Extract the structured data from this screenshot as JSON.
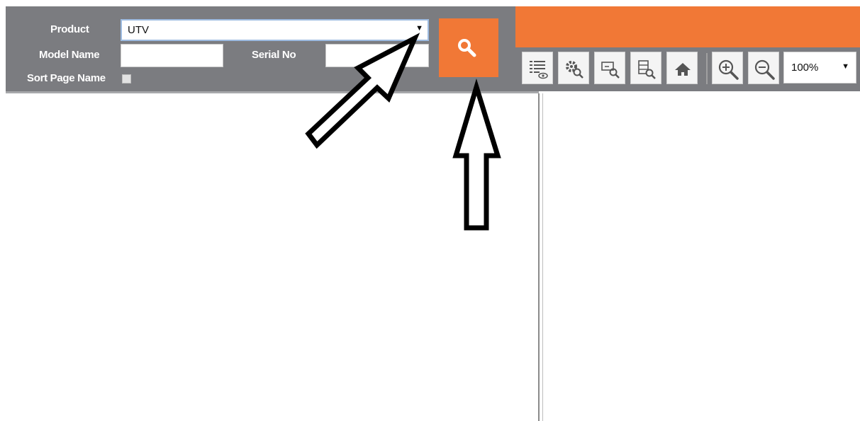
{
  "filter": {
    "product_label": "Product",
    "product_value": "UTV",
    "model_name_label": "Model Name",
    "model_name_value": "",
    "serial_no_label": "Serial No",
    "serial_no_value": "",
    "sort_page_name_label": "Sort Page Name",
    "sort_page_name_checked": false
  },
  "search_button": {
    "icon": "search-icon"
  },
  "toolbar": {
    "buttons": [
      {
        "icon": "list-view-icon"
      },
      {
        "icon": "gear-search-icon"
      },
      {
        "icon": "part-search-icon"
      },
      {
        "icon": "table-search-icon"
      },
      {
        "icon": "home-icon"
      },
      {
        "icon": "zoom-in-icon"
      },
      {
        "icon": "zoom-out-icon"
      }
    ],
    "zoom_value": "100%"
  },
  "colors": {
    "accent": "#f17836",
    "panel": "#7b7c80",
    "toolbar_button": "#f4f4f4"
  }
}
